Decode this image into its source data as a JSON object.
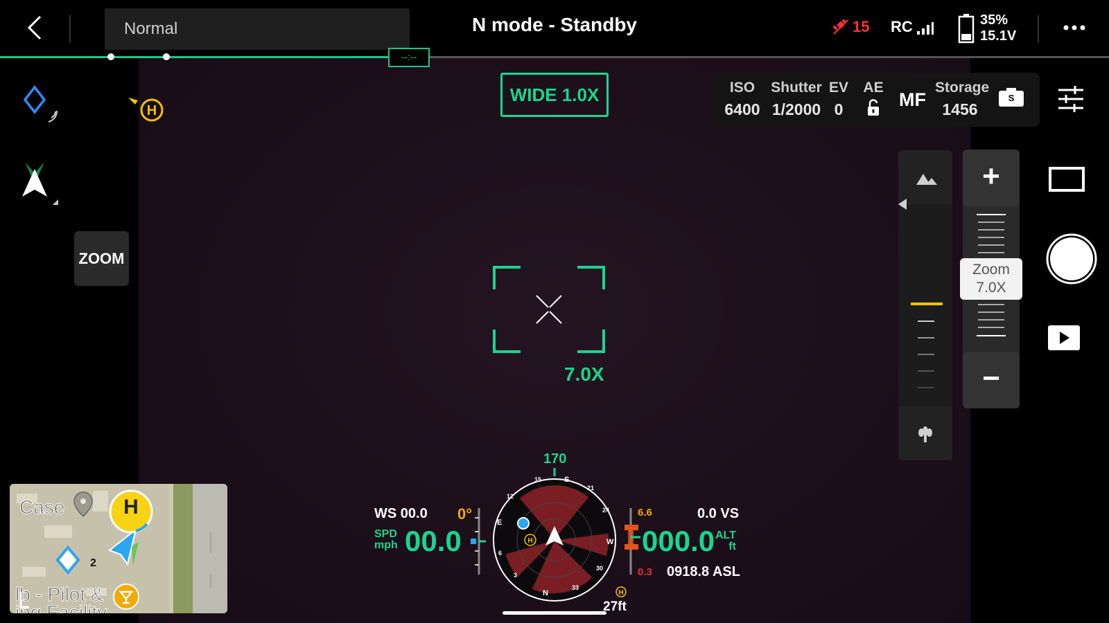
{
  "topbar": {
    "mode_select": "Normal",
    "status_title": "N mode - Standby",
    "gps_count": "15",
    "rc_label": "RC",
    "battery_percent": "35%",
    "battery_voltage": "15.1V",
    "track_label": "--:--"
  },
  "camera": {
    "lens_button": "WIDE  1.0X",
    "iso_label": "ISO",
    "iso_value": "6400",
    "shutter_label": "Shutter",
    "shutter_value": "1/2000",
    "ev_label": "EV",
    "ev_value": "0",
    "ae_label": "AE",
    "focus_mode": "MF",
    "storage_label": "Storage",
    "storage_value": "1456",
    "storage_badge": "S",
    "zoom_reading": "7.0X"
  },
  "left_panel": {
    "zoom_button": "ZOOM",
    "home_marker": "H"
  },
  "zoom_control": {
    "tooltip_label": "Zoom",
    "tooltip_value": "7.0X",
    "plus": "+",
    "minus": "−",
    "level": 0.3
  },
  "telemetry": {
    "ws": "WS 00.0",
    "gimbal_angle": "0°",
    "spd_unit_top": "SPD",
    "spd_unit_bottom": "mph",
    "speed": "00.0",
    "vs_top": "6.6",
    "vs": "0.0 VS",
    "altitude": "000.0",
    "alt_unit_top": "ALT",
    "alt_unit_bottom": "ft",
    "vs_bottom": "0.3",
    "asl": "0918.8 ASL",
    "heading": "170",
    "home_distance": "27ft",
    "compass": [
      "S",
      "24",
      "W",
      "30",
      "33",
      "N",
      "3",
      "6",
      "E",
      "12",
      "15",
      "21"
    ]
  },
  "minimap": {
    "label_case": "Case",
    "label_pilot": "lb - Pilot &",
    "label_facility": "ing Facility",
    "waypoint_number": "2",
    "home": "H"
  },
  "colors": {
    "accent_green": "#19d68e",
    "warning_red": "#e83030",
    "home_yellow": "#f2c200",
    "focus_orange": "#f2a900"
  }
}
